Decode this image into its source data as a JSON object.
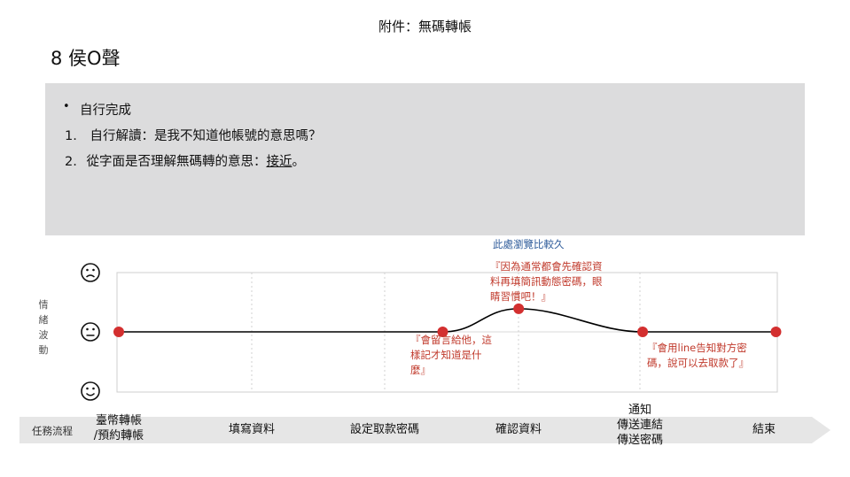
{
  "page": {
    "title": "附件：無碼轉帳",
    "user_title": "8 侯O聲"
  },
  "notes": {
    "bullet_label": "自行完成",
    "items": [
      {
        "num": "1.",
        "pre": "自行解讀：是我不知道他帳號的意思嗎？",
        "u": "",
        "post": ""
      },
      {
        "num": "2.",
        "pre": "從字面是否理解無碼轉的意思：",
        "u": "接近",
        "post": "。"
      }
    ]
  },
  "emotion_axis": {
    "label": [
      "情",
      "緒",
      "波",
      "動"
    ],
    "faces": [
      "frown-face-icon",
      "neutral-face-icon",
      "smile-face-icon"
    ]
  },
  "flow": {
    "label": "任務流程",
    "stages": [
      {
        "lines": [
          "臺幣轉帳",
          "/預約轉帳"
        ]
      },
      {
        "lines": [
          "填寫資料"
        ]
      },
      {
        "lines": [
          "設定取款密碼"
        ]
      },
      {
        "lines": [
          "確認資料"
        ]
      },
      {
        "lines": [
          "通知",
          "傳送連結",
          "傳送密碼"
        ]
      },
      {
        "lines": [
          "結束"
        ]
      }
    ]
  },
  "annotations": {
    "browse_note": "此處瀏覽比較久",
    "a1": [
      "『因為通常都會先確認資",
      "料再填簡訊動態密碼，眼",
      "睛習慣吧！』"
    ],
    "a2": [
      "『會留言給他，這",
      "樣記才知道是什",
      "麼』"
    ],
    "a3": [
      "『會用line告知對方密",
      "碼，說可以去取款了』"
    ]
  },
  "chart_data": {
    "type": "line",
    "x": [
      "臺幣轉帳/預約轉帳",
      "填寫資料",
      "設定取款密碼",
      "確認資料",
      "通知/傳送連結/傳送密碼",
      "結束"
    ],
    "points": [
      {
        "x": 0,
        "y": 0
      },
      {
        "x": 2.43,
        "y": 0
      },
      {
        "x": 3.0,
        "y": 0.39
      },
      {
        "x": 3.93,
        "y": 0
      },
      {
        "x": 4.93,
        "y": 0
      }
    ],
    "ylim": [
      -1,
      1
    ],
    "y_levels": {
      "-1": "smile-face-icon",
      "0": "neutral-face-icon",
      "1": "frown-face-icon"
    },
    "line_color": "#000000",
    "point_color": "#d32f2f",
    "grid": true
  }
}
